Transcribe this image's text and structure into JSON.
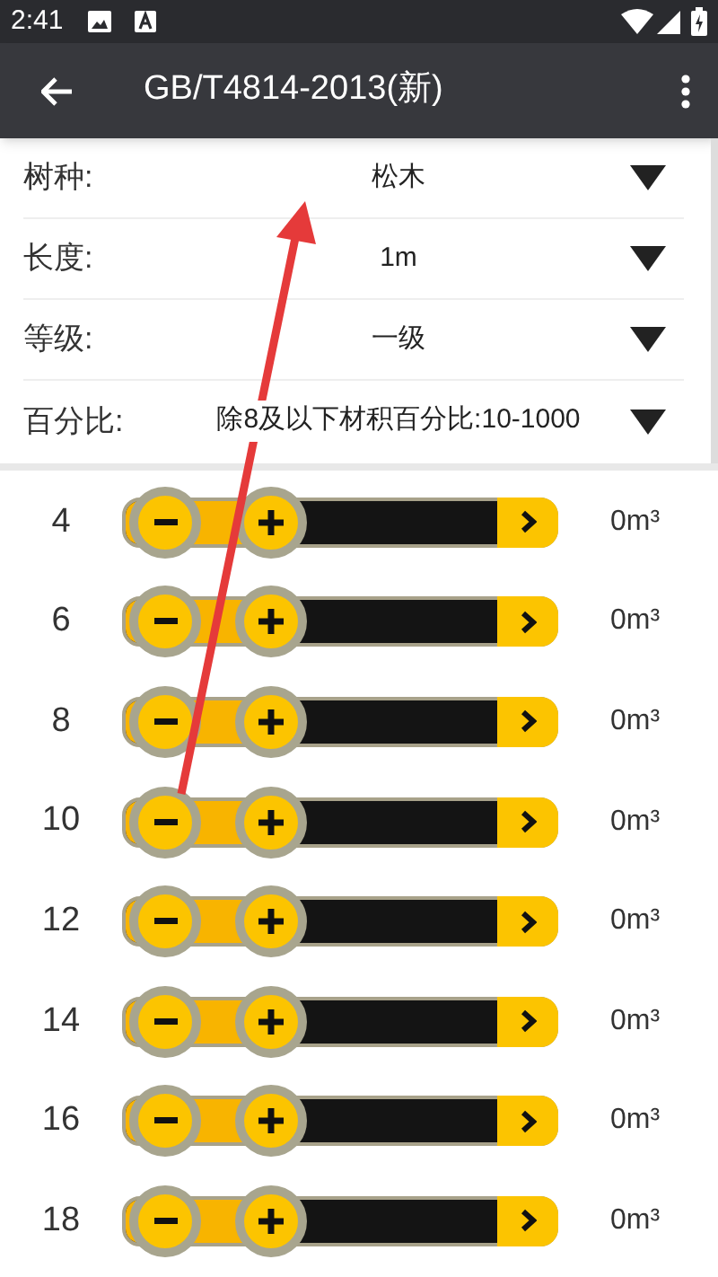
{
  "status_bar": {
    "time": "2:41"
  },
  "app_bar": {
    "title": "GB/T4814-2013(新)"
  },
  "fields": [
    {
      "label": "树种:",
      "value": "松木"
    },
    {
      "label": "长度:",
      "value": "1m"
    },
    {
      "label": "等级:",
      "value": "一级"
    },
    {
      "label": "百分比:",
      "value": "除8及以下材积百分比:10-1000"
    }
  ],
  "diameters": [
    {
      "label": "4",
      "volume": "0m³"
    },
    {
      "label": "6",
      "volume": "0m³"
    },
    {
      "label": "8",
      "volume": "0m³"
    },
    {
      "label": "10",
      "volume": "0m³"
    },
    {
      "label": "12",
      "volume": "0m³"
    },
    {
      "label": "14",
      "volume": "0m³"
    },
    {
      "label": "16",
      "volume": "0m³"
    },
    {
      "label": "18",
      "volume": "0m³"
    }
  ]
}
